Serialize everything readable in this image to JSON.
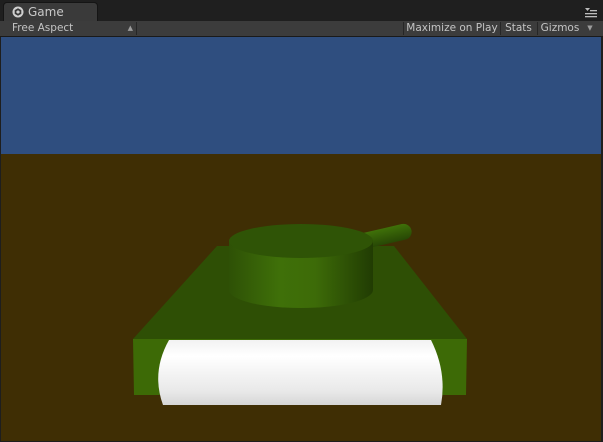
{
  "tab": {
    "title": "Game",
    "icon": "unity-logo-icon"
  },
  "panel_menu_icon": "menu-icon",
  "toolbar": {
    "aspect_value": "Free Aspect",
    "maximize_label": "Maximize on Play",
    "stats_label": "Stats",
    "gizmos_label": "Gizmos"
  },
  "scene": {
    "sky_color": "#2f4e7f",
    "ground_color": "#3f2e04",
    "tank_body_color": "#2e4f05",
    "turret_color": "#3d6b08",
    "track_color": "#ffffff"
  }
}
